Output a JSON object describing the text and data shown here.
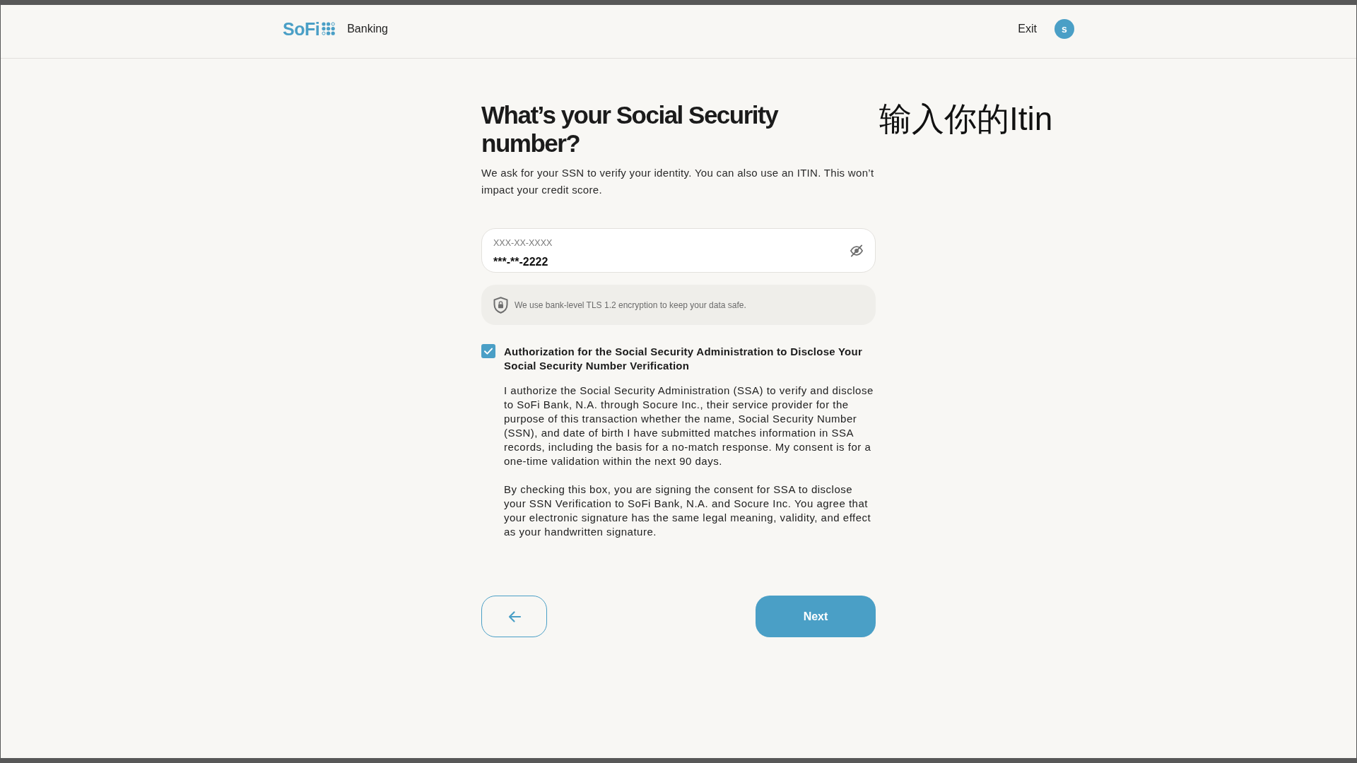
{
  "header": {
    "logo_text": "SoFi",
    "section": "Banking",
    "exit_link": "Exit",
    "avatar_initial": "s"
  },
  "annotation": "输入你的Itin",
  "heading": "What’s your Social Security number?",
  "subtitle": "We ask for your SSN to verify your identity. You can also use an ITIN. This won’t impact your credit score.",
  "ssn_field": {
    "label": "XXX-XX-XXXX",
    "value": "***-**-2222",
    "masked": true
  },
  "security_note": "We use bank-level TLS 1.2 encryption to keep your data safe.",
  "consent": {
    "checked": true,
    "title": "Authorization for the Social Security Administration to Disclose Your Social Security Number Verification",
    "paragraphs": [
      "I authorize the Social Security Administration (SSA) to verify and disclose to SoFi Bank, N.A. through Socure Inc., their service provider for the purpose of this transaction whether the name, Social Security Number (SSN), and date of birth I have submitted matches information in SSA records, including the basis for a no-match response. My consent is for a one-time validation within the next 90 days.",
      "By checking this box, you are signing the consent for SSA to disclose your SSN Verification to SoFi Bank, N.A. and Socure Inc. You agree that your electronic signature has the same legal meaning, validity, and effect as your handwritten signature."
    ]
  },
  "buttons": [
    {
      "kind": "back"
    },
    {
      "kind": "primary",
      "label": "Next"
    }
  ]
}
